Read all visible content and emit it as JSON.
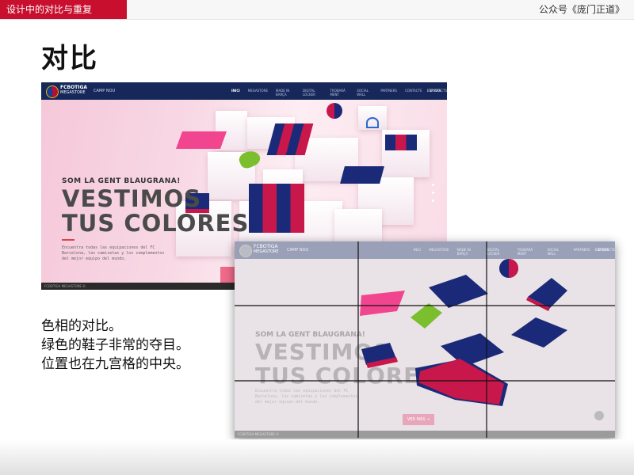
{
  "header": {
    "section_label": "设计中的对比与重复",
    "account": "公众号《庞门正道》"
  },
  "slide": {
    "title": "对比",
    "description": [
      "色相的对比。",
      "绿色的鞋子非常的夺目。",
      "位置也在九宫格的中央。"
    ]
  },
  "website": {
    "brand_line1": "FCBOTIGA",
    "brand_line2": "MEGASTORE",
    "nav_sub": "CAMP NOU",
    "nav_items": [
      "INICI",
      "MEGASTORE",
      "MADE IN BARÇA",
      "DIGITAL LOCKER",
      "TROBARÀ MENT",
      "SOCIAL WALL",
      "PARTNERS",
      "CONTACTE",
      "CONTACTS"
    ],
    "language": "ESP  CAS",
    "tagline": "SOM LA GENT BLAUGRANA!",
    "headline_line1": "VESTIMOS",
    "headline_line2": "TUS COLORES",
    "body_text": "Encuentra todas las equipaciones del FC Barcelona, las camisetas y los complementos del mejor equipo del mundo.",
    "footer": "FCBOTIGA MEGASTORE ©",
    "button": "VER MÁS →"
  },
  "colors": {
    "accent_red": "#c8102e",
    "barca_blue": "#1a2a78",
    "barca_red": "#c8174b",
    "pink": "#f2458f",
    "green": "#7bbf2e"
  }
}
